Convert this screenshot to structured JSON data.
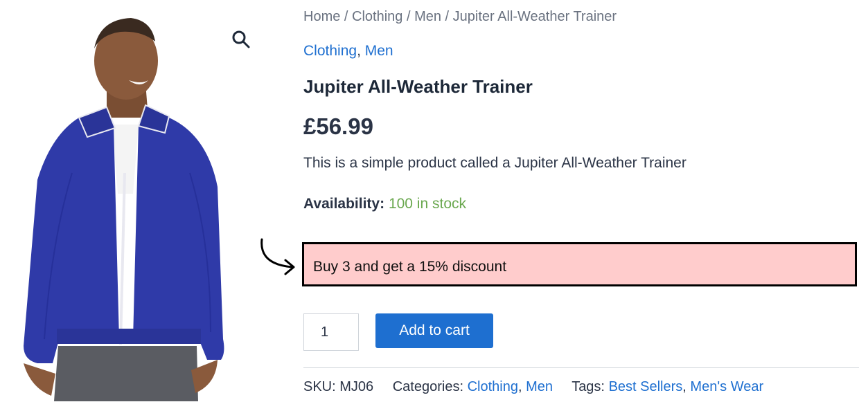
{
  "product_image": {
    "alt": "Man wearing blue Jupiter All-Weather Trainer jacket",
    "jacket_color": "#2f3aa8"
  },
  "zoom": {
    "icon": "magnifier-icon"
  },
  "breadcrumb": {
    "home": "Home",
    "sep": " / ",
    "level1": "Clothing",
    "level2": "Men",
    "current": "Jupiter All-Weather Trainer"
  },
  "categories_top": {
    "first": "Clothing",
    "comma": ", ",
    "second": "Men"
  },
  "product": {
    "title": "Jupiter All-Weather Trainer",
    "price": "£56.99",
    "description": "This is a simple product called a Jupiter All-Weather Trainer",
    "availability_label": "Availability:",
    "availability_value": "100 in stock"
  },
  "promo": {
    "text": "Buy 3 and get a 15% discount",
    "background": "#ffcccc",
    "border": "#000000"
  },
  "cart": {
    "quantity": "1",
    "button_label": "Add to cart",
    "button_color": "#1e6fd0"
  },
  "meta": {
    "sku_label": "SKU:",
    "sku_value": "MJ06",
    "categories_label": "Categories:",
    "cat1": "Clothing",
    "cat2": "Men",
    "tags_label": "Tags:",
    "tag1": "Best Sellers",
    "tag2": "Men's Wear",
    "comma": ", "
  },
  "colors": {
    "link": "#1e6fd0",
    "in_stock": "#6aa84f",
    "text": "#2b3446"
  }
}
